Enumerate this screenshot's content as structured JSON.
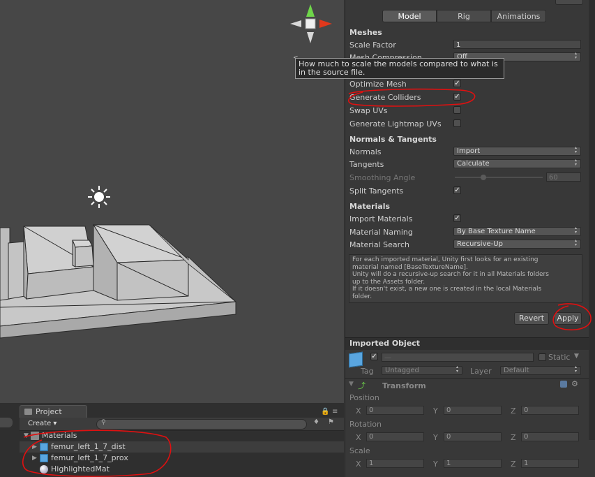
{
  "tooltip": {
    "line1": "How much to scale the models compared to what is",
    "line2": "in the source file."
  },
  "project": {
    "tab_label": "Project",
    "create_label": "Create",
    "items": [
      {
        "label": "Materials",
        "icon": "folder-icon"
      },
      {
        "label": "femur_left_1_7_dist",
        "icon": "mesh-icon"
      },
      {
        "label": "femur_left_1_7_prox",
        "icon": "mesh-icon"
      },
      {
        "label": "HighlightedMat",
        "icon": "material-icon"
      }
    ]
  },
  "inspector": {
    "tabs": [
      "Model",
      "Rig",
      "Animations"
    ],
    "active_tab": "Model",
    "meshes": {
      "title": "Meshes",
      "scale_factor_label": "Scale Factor",
      "scale_factor_value": "1",
      "mesh_compression_label": "Mesh Compression",
      "mesh_compression_value": "Off",
      "optimize_mesh_label": "Optimize Mesh",
      "generate_colliders_label": "Generate Colliders",
      "swap_uvs_label": "Swap UVs",
      "generate_lightmap_uvs_label": "Generate Lightmap UVs"
    },
    "normals": {
      "title": "Normals & Tangents",
      "normals_label": "Normals",
      "normals_value": "Import",
      "tangents_label": "Tangents",
      "tangents_value": "Calculate",
      "smoothing_label": "Smoothing Angle",
      "smoothing_value": "60",
      "split_tangents_label": "Split Tangents"
    },
    "materials": {
      "title": "Materials",
      "import_label": "Import Materials",
      "naming_label": "Material Naming",
      "naming_value": "By Base Texture Name",
      "search_label": "Material Search",
      "search_value": "Recursive-Up",
      "info": "For each imported material, Unity first looks for an existing\nmaterial named [BaseTextureName].\nUnity will do a recursive-up search for it in all Materials folders\nup to the Assets folder.\nIf it doesn't exist, a new one is created in the local Materials\nfolder."
    },
    "revert_label": "Revert",
    "apply_label": "Apply",
    "imported_object": {
      "title": "Imported Object",
      "name_placeholder": "—",
      "static_label": "Static",
      "tag_label": "Tag",
      "tag_value": "Untagged",
      "layer_label": "Layer",
      "layer_value": "Default"
    },
    "transform": {
      "title": "Transform",
      "position_label": "Position",
      "rotation_label": "Rotation",
      "scale_label": "Scale",
      "axes": [
        "X",
        "Y",
        "Z"
      ],
      "position": [
        "0",
        "0",
        "0"
      ],
      "rotation": [
        "0",
        "0",
        "0"
      ],
      "scale": [
        "1",
        "1",
        "1"
      ]
    }
  },
  "colors": {
    "annotation": "#e01010",
    "gizmo_y": "#6fd64a",
    "gizmo_x": "#e0381c"
  }
}
